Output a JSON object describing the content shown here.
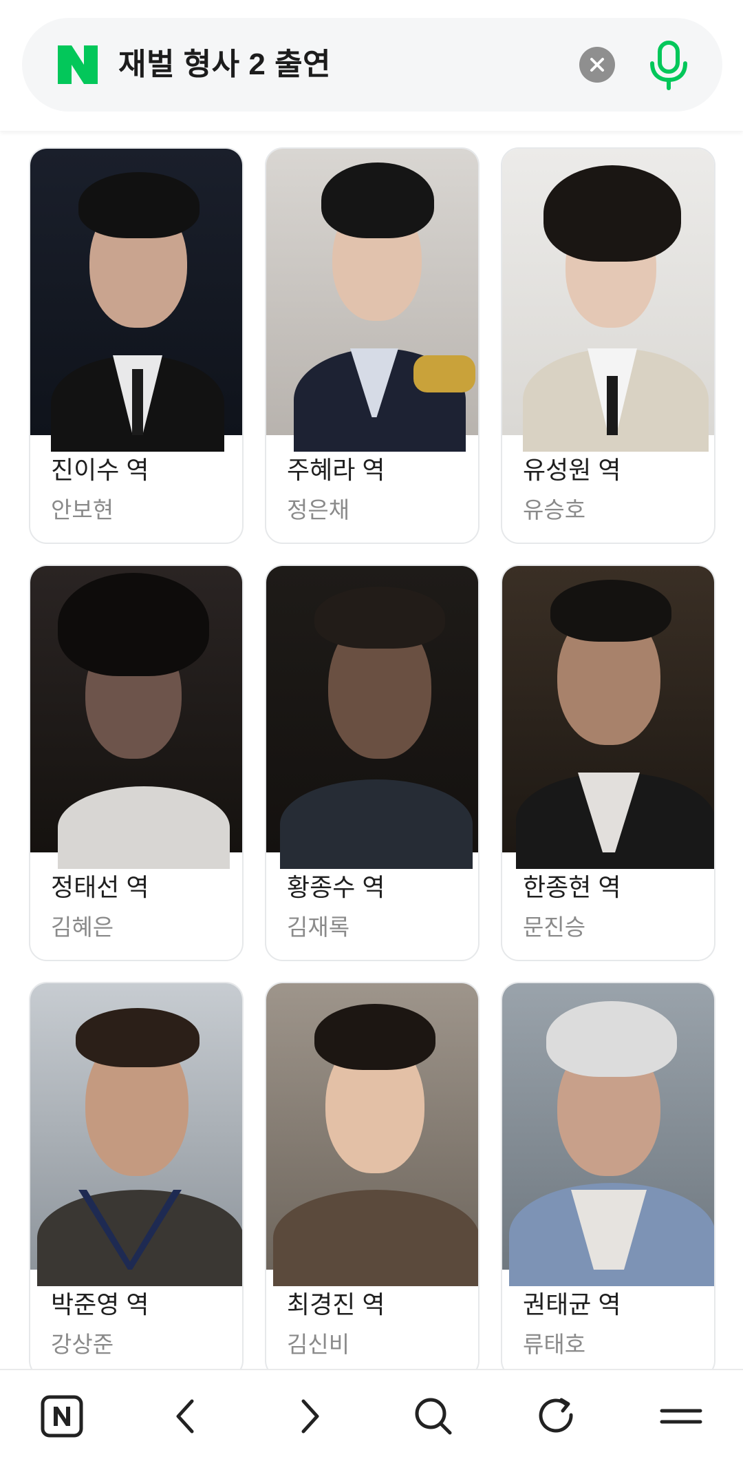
{
  "search": {
    "query": "재벌 형사 2 출연",
    "logo_letter": "N",
    "logo_color": "#03c75a",
    "clear_icon": "close-icon",
    "mic_icon": "microphone-icon"
  },
  "cast": [
    {
      "role": "진이수 역",
      "actor": "안보현"
    },
    {
      "role": "주혜라 역",
      "actor": "정은채"
    },
    {
      "role": "유성원 역",
      "actor": "유승호"
    },
    {
      "role": "정태선 역",
      "actor": "김혜은"
    },
    {
      "role": "황종수 역",
      "actor": "김재록"
    },
    {
      "role": "한종현 역",
      "actor": "문진승"
    },
    {
      "role": "박준영 역",
      "actor": "강상준"
    },
    {
      "role": "최경진 역",
      "actor": "김신비"
    },
    {
      "role": "권태균 역",
      "actor": "류태호"
    }
  ],
  "bottom_nav": [
    {
      "name": "naver-home-icon"
    },
    {
      "name": "back-icon"
    },
    {
      "name": "forward-icon"
    },
    {
      "name": "search-icon"
    },
    {
      "name": "refresh-icon"
    },
    {
      "name": "menu-icon"
    }
  ]
}
